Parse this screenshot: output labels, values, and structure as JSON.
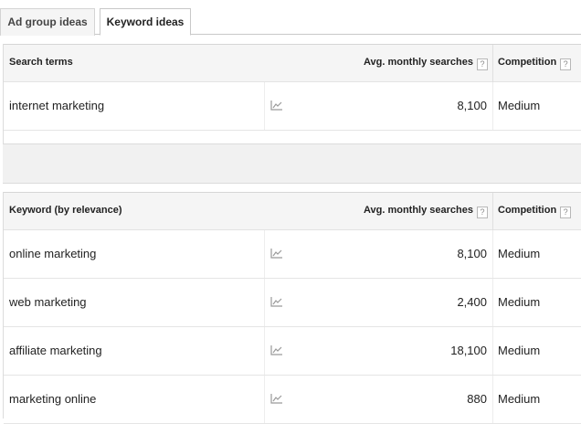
{
  "tabs": [
    {
      "label": "Ad group ideas"
    },
    {
      "label": "Keyword ideas"
    }
  ],
  "search_table": {
    "headers": {
      "term": "Search terms",
      "searches": "Avg. monthly searches",
      "competition": "Competition",
      "help": "?"
    },
    "rows": [
      {
        "keyword": "internet marketing",
        "searches": "8,100",
        "competition": "Medium"
      }
    ]
  },
  "keyword_table": {
    "headers": {
      "term": "Keyword (by relevance)",
      "searches": "Avg. monthly searches",
      "competition": "Competition",
      "help": "?"
    },
    "rows": [
      {
        "keyword": "online marketing",
        "searches": "8,100",
        "competition": "Medium"
      },
      {
        "keyword": "web marketing",
        "searches": "2,400",
        "competition": "Medium"
      },
      {
        "keyword": "affiliate marketing",
        "searches": "18,100",
        "competition": "Medium"
      },
      {
        "keyword": "marketing online",
        "searches": "880",
        "competition": "Medium"
      }
    ]
  }
}
